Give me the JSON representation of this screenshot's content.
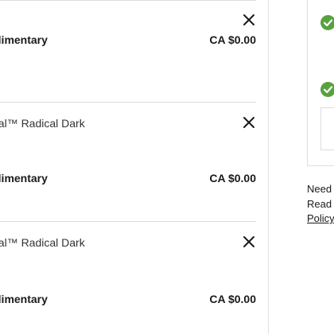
{
  "cart": {
    "items": [
      {
        "title": "",
        "fee_label": "Complimentary",
        "price": "CA $0.00",
        "remove_icon": "close-icon"
      },
      {
        "title": "Tactical™ Radical Dark",
        "fee_label": "Complimentary",
        "price": "CA $0.00",
        "remove_icon": "close-icon"
      },
      {
        "title": "Tactical™ Radical Dark",
        "fee_label": "Complimentary",
        "price": "CA $0.00",
        "remove_icon": "close-icon"
      }
    ]
  },
  "side": {
    "status_icon": "check-circle-icon",
    "status_color": "#58a13f",
    "help_line_1": "Need",
    "help_line_2": "Read",
    "help_link": "Policy"
  }
}
